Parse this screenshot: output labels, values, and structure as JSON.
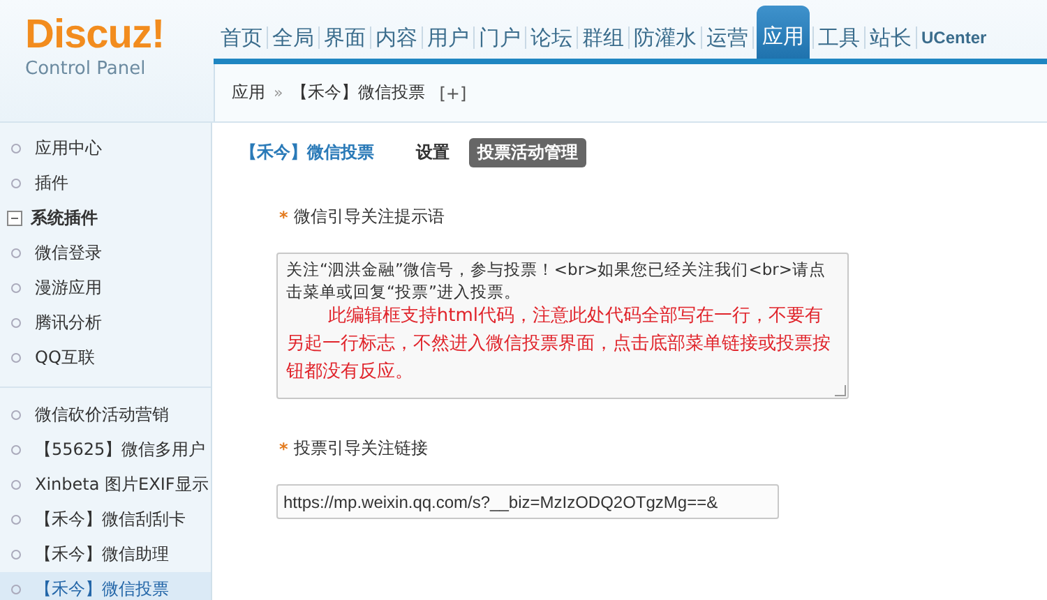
{
  "logo": {
    "title": "Discuz",
    "mark": "!",
    "subtitle": "Control Panel"
  },
  "nav": [
    {
      "label": "首页",
      "selected": false
    },
    {
      "label": "全局",
      "selected": false
    },
    {
      "label": "界面",
      "selected": false
    },
    {
      "label": "内容",
      "selected": false
    },
    {
      "label": "用户",
      "selected": false
    },
    {
      "label": "门户",
      "selected": false
    },
    {
      "label": "论坛",
      "selected": false
    },
    {
      "label": "群组",
      "selected": false
    },
    {
      "label": "防灌水",
      "selected": false
    },
    {
      "label": "运营",
      "selected": false
    },
    {
      "label": "应用",
      "selected": true
    },
    {
      "label": "工具",
      "selected": false
    },
    {
      "label": "站长",
      "selected": false
    },
    {
      "label": "UCenter",
      "selected": false
    }
  ],
  "breadcrumb": {
    "items": [
      "应用",
      "【禾今】微信投票"
    ],
    "separator": "»",
    "add": "[+]"
  },
  "sidebar": {
    "sections": [
      {
        "items": [
          {
            "label": "应用中心",
            "selected": false
          },
          {
            "label": "插件",
            "selected": false
          },
          {
            "label": "系统插件",
            "kind": "group",
            "expanded": true,
            "children": [
              {
                "label": "微信登录",
                "selected": false
              },
              {
                "label": "漫游应用",
                "selected": false
              },
              {
                "label": "腾讯分析",
                "selected": false
              },
              {
                "label": "QQ互联",
                "selected": false
              }
            ]
          }
        ]
      },
      {
        "items": [
          {
            "label": "微信砍价活动营销",
            "selected": false
          },
          {
            "label": "【55625】微信多用户",
            "selected": false
          },
          {
            "label": "Xinbeta 图片EXIF显示",
            "selected": false
          },
          {
            "label": "【禾今】微信刮刮卡",
            "selected": false
          },
          {
            "label": "【禾今】微信助理",
            "selected": false
          },
          {
            "label": "【禾今】微信投票",
            "selected": true
          }
        ]
      }
    ]
  },
  "subnav": {
    "title": "【禾今】微信投票",
    "tabs": [
      {
        "label": "设置",
        "selected": false
      },
      {
        "label": "投票活动管理",
        "selected": true
      }
    ]
  },
  "form": {
    "fields": [
      {
        "kind": "textarea",
        "label": "微信引导关注提示语",
        "marker": "*",
        "value": "关注“泗洪金融”微信号，参与投票！<br>如果您已经关注我们<br>请点击菜单或回复“投票”进入投票。",
        "note": "此编辑框支持html代码，注意此处代码全部写在一行，不要有另起一行标志，不然进入微信投票界面，点击底部菜单链接或投票按钮都没有反应。"
      },
      {
        "kind": "input",
        "label": "投票引导关注链接",
        "marker": "*",
        "value": "https://mp.weixin.qq.com/s?__biz=MzIzODQ2OTgzMg==&"
      }
    ]
  }
}
